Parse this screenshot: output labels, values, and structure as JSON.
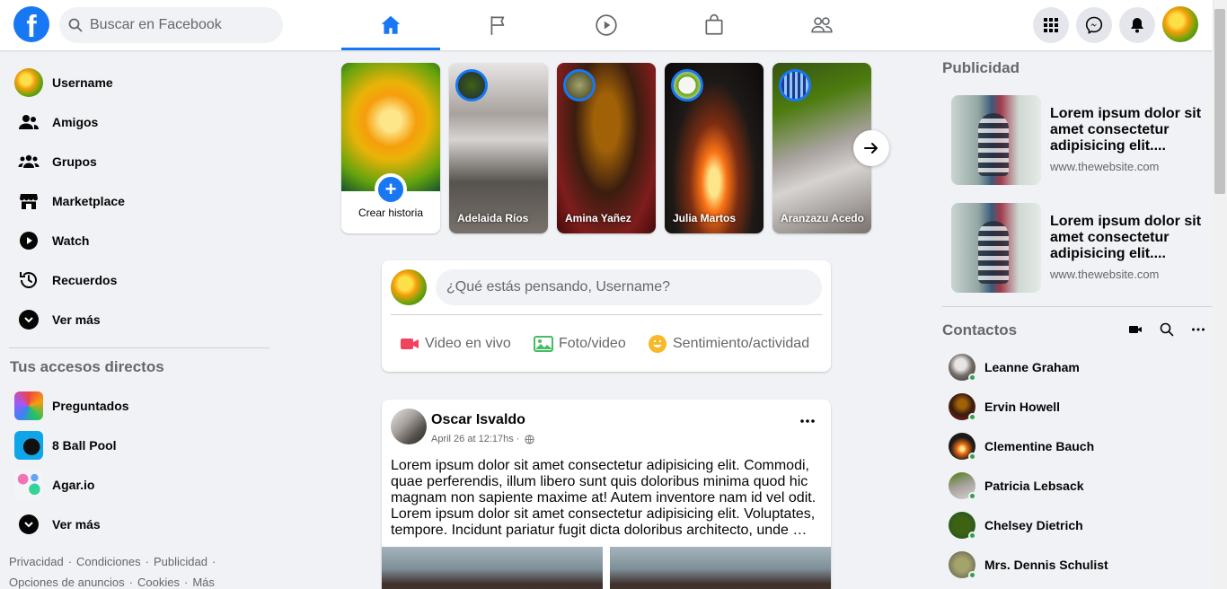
{
  "colors": {
    "brand": "#1877f2",
    "online": "#31a24c",
    "live_video": "#f3425f",
    "photo": "#45bd62",
    "feeling": "#f7b928"
  },
  "header": {
    "logo_letter": "f",
    "search_placeholder": "Buscar en Facebook",
    "nav_tabs": [
      {
        "icon": "home-icon",
        "active": true
      },
      {
        "icon": "flag-icon",
        "active": false
      },
      {
        "icon": "watch-play-icon",
        "active": false
      },
      {
        "icon": "marketplace-bag-icon",
        "active": false
      },
      {
        "icon": "groups-icon",
        "active": false
      }
    ],
    "right_buttons": [
      "menu-grid-icon",
      "messenger-icon",
      "notifications-bell-icon"
    ]
  },
  "sidebar": {
    "items": [
      {
        "label": "Username",
        "icon": "avatar"
      },
      {
        "label": "Amigos",
        "icon": "friends-icon"
      },
      {
        "label": "Grupos",
        "icon": "groups-icon"
      },
      {
        "label": "Marketplace",
        "icon": "store-icon"
      },
      {
        "label": "Watch",
        "icon": "play-icon"
      },
      {
        "label": "Recuerdos",
        "icon": "clock-history-icon"
      },
      {
        "label": "Ver más",
        "icon": "chevron-down-icon"
      }
    ],
    "shortcuts_title": "Tus accesos directos",
    "shortcuts": [
      {
        "label": "Preguntados"
      },
      {
        "label": "8 Ball Pool"
      },
      {
        "label": "Agar.io"
      },
      {
        "label": "Ver más"
      }
    ],
    "footer": {
      "line1": [
        "Privacidad",
        "Condiciones",
        "Publicidad"
      ],
      "line2": [
        "Opciones de anuncios",
        "Cookies",
        "Más"
      ]
    }
  },
  "stories": {
    "create_label": "Crear historia",
    "items": [
      {
        "name": "Adelaida Ríos"
      },
      {
        "name": "Amina Yañez"
      },
      {
        "name": "Julia Martos"
      },
      {
        "name": "Aranzazu Acedo"
      }
    ]
  },
  "composer": {
    "placeholder": "¿Qué estás pensando, Username?",
    "actions": [
      "Video en vivo",
      "Foto/video",
      "Sentimiento/actividad"
    ]
  },
  "post": {
    "author": "Oscar Isvaldo",
    "timestamp": "April 26 at 12:17hs",
    "text": "Lorem ipsum dolor sit amet consectetur adipisicing elit. Commodi, quae perferendis, illum libero sunt quis doloribus minima quod hic magnam non sapiente maxime at! Autem inventore nam id vel odit. Lorem ipsum dolor sit amet consectetur adipisicing elit. Voluptates, tempore. Incidunt pariatur fugit dicta doloribus architecto, unde …"
  },
  "right": {
    "ads_title": "Publicidad",
    "ads": [
      {
        "title": "Lorem ipsum dolor sit amet consectetur adipisicing elit....",
        "url": "www.thewebsite.com"
      },
      {
        "title": "Lorem ipsum dolor sit amet consectetur adipisicing elit....",
        "url": "www.thewebsite.com"
      }
    ],
    "contacts_title": "Contactos",
    "contacts": [
      {
        "name": "Leanne Graham"
      },
      {
        "name": "Ervin Howell"
      },
      {
        "name": "Clementine Bauch"
      },
      {
        "name": "Patricia Lebsack"
      },
      {
        "name": "Chelsey Dietrich"
      },
      {
        "name": "Mrs. Dennis Schulist"
      }
    ]
  }
}
